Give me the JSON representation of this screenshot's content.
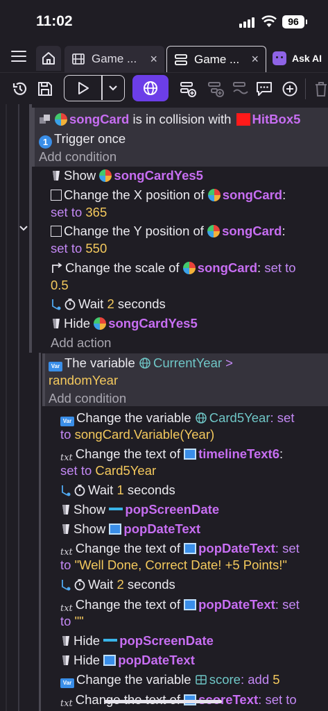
{
  "status": {
    "time": "11:02",
    "battery": "96"
  },
  "tabs": [
    {
      "label": "Game ...",
      "close": "×"
    },
    {
      "label": "Game ...",
      "close": "×"
    }
  ],
  "ask_ai": "Ask AI",
  "events": {
    "cond1": {
      "obj": "songCard",
      "text": " is in collision with ",
      "target": "HitBox5",
      "trigger": "Trigger once",
      "add_condition": "Add condition"
    },
    "actions1": {
      "show": "Show ",
      "show_obj": "songCardYes5",
      "chx_a": "Change the X position of ",
      "chx_obj": "songCard",
      "colon": ":",
      "set_to": "set to ",
      "x_val": "365",
      "chy_a": "Change the Y position of ",
      "chy_obj": "songCard",
      "y_val": "550",
      "scale_a": "Change the scale of ",
      "scale_obj": "songCard",
      "scale_set": " set to",
      "scale_val": "0.5",
      "wait": "Wait ",
      "wait_val": "2",
      "seconds": " seconds",
      "hide": "Hide ",
      "hide_obj": "songCardYes5",
      "add_action": "Add action"
    },
    "cond2": {
      "text": "The variable ",
      "var": "CurrentYear",
      "op": " >",
      "rhs": "randomYear",
      "add_condition": "Add condition"
    },
    "actions2": {
      "chv_a": "Change the variable ",
      "chv_var": "Card5Year",
      "chv_set": ": set",
      "chv_to": "to ",
      "chv_val": "songCard.Variable(Year)",
      "cht_a": "Change the text of ",
      "cht_obj": "timelineText6",
      "cht_colon": ":",
      "cht_set": "set to ",
      "cht_val": "Card5Year",
      "wait1": "Wait ",
      "wait1_val": "1",
      "wait1_sec": " seconds",
      "show1": "Show ",
      "show1_obj": "popScreenDate",
      "show2": "Show ",
      "show2_obj": "popDateText",
      "cht2_a": "Change the text of ",
      "cht2_obj": "popDateText",
      "cht2_set": ": set",
      "cht2_to": "to ",
      "cht2_val": "\"Well Done, Correct Date! +5 Points!\"",
      "wait2": "Wait ",
      "wait2_val": "2",
      "wait2_sec": " seconds",
      "cht3_a": "Change the text of ",
      "cht3_obj": "popDateText",
      "cht3_set": ": set",
      "cht3_to": "to ",
      "cht3_val": "\"\"",
      "hide1": "Hide ",
      "hide1_obj": "popScreenDate",
      "hide2": "Hide ",
      "hide2_obj": "popDateText",
      "score_a": "Change the variable ",
      "score_var": "score",
      "score_add": ": add ",
      "score_val": "5",
      "last_a": "Change the text of ",
      "last_obj": "scoreText",
      "last_set": ": set to"
    }
  },
  "colors": {
    "object": "#c76ef2",
    "variable": "#6fc6c6",
    "number": "#f4c95d",
    "accent": "#6c3ee8"
  }
}
